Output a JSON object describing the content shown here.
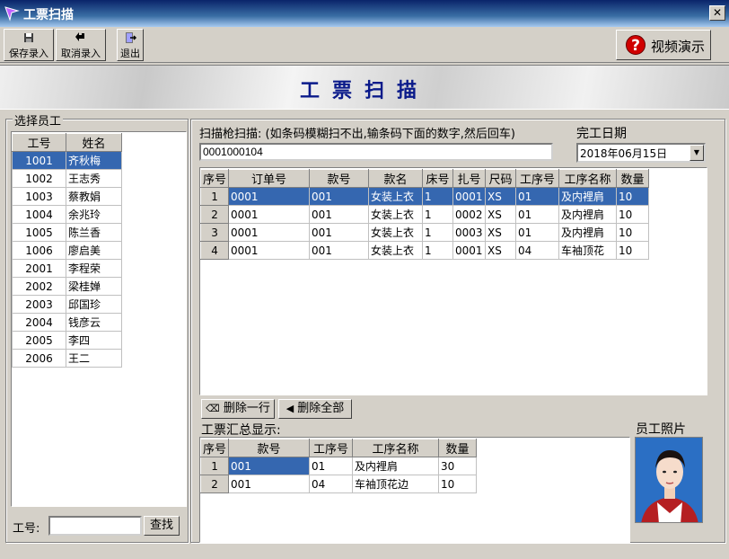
{
  "window": {
    "title": "工票扫描"
  },
  "toolbar": {
    "save_label": "保存录入",
    "cancel_label": "取消录入",
    "exit_label": "退出",
    "video_label": "视频演示"
  },
  "banner": {
    "title": "工票扫描"
  },
  "employees": {
    "group_label": "选择员工",
    "headers": [
      "工号",
      "姓名"
    ],
    "rows": [
      [
        "1001",
        "齐秋梅"
      ],
      [
        "1002",
        "王志秀"
      ],
      [
        "1003",
        "蔡教娟"
      ],
      [
        "1004",
        "余兆玲"
      ],
      [
        "1005",
        "陈兰香"
      ],
      [
        "1006",
        "廖启美"
      ],
      [
        "2001",
        "李程荣"
      ],
      [
        "2002",
        "梁桂婵"
      ],
      [
        "2003",
        "邱国珍"
      ],
      [
        "2004",
        "钱彦云"
      ],
      [
        "2005",
        "李四"
      ],
      [
        "2006",
        "王二"
      ]
    ],
    "selected_index": 0,
    "id_label": "工号:",
    "id_value": "",
    "search_label": "查找"
  },
  "scan": {
    "label": "扫描枪扫描:",
    "hint": "(如条码模糊扫不出,输条码下面的数字,然后回车)",
    "value": "0001000104",
    "finish_date_label": "完工日期",
    "finish_date_value": "2018年06月15日"
  },
  "scan_table": {
    "headers": [
      "序号",
      "订单号",
      "款号",
      "款名",
      "床号",
      "扎号",
      "尺码",
      "工序号",
      "工序名称",
      "数量"
    ],
    "rows": [
      [
        "1",
        "0001",
        "001",
        "女装上衣",
        "1",
        "0001",
        "XS",
        "01",
        "及内裡肩",
        "10"
      ],
      [
        "2",
        "0001",
        "001",
        "女装上衣",
        "1",
        "0002",
        "XS",
        "01",
        "及内裡肩",
        "10"
      ],
      [
        "3",
        "0001",
        "001",
        "女装上衣",
        "1",
        "0003",
        "XS",
        "01",
        "及内裡肩",
        "10"
      ],
      [
        "4",
        "0001",
        "001",
        "女装上衣",
        "1",
        "0001",
        "XS",
        "04",
        "车袖顶花",
        "10"
      ]
    ],
    "selected_index": 0
  },
  "actions": {
    "delete_row_label": "删除一行",
    "delete_all_label": "删除全部"
  },
  "summary": {
    "label": "工票汇总显示:",
    "headers": [
      "序号",
      "款号",
      "工序号",
      "工序名称",
      "数量"
    ],
    "rows": [
      [
        "1",
        "001",
        "01",
        "及内裡肩",
        "30"
      ],
      [
        "2",
        "001",
        "04",
        "车袖顶花边",
        "10"
      ]
    ]
  },
  "photo": {
    "label": "员工照片"
  }
}
